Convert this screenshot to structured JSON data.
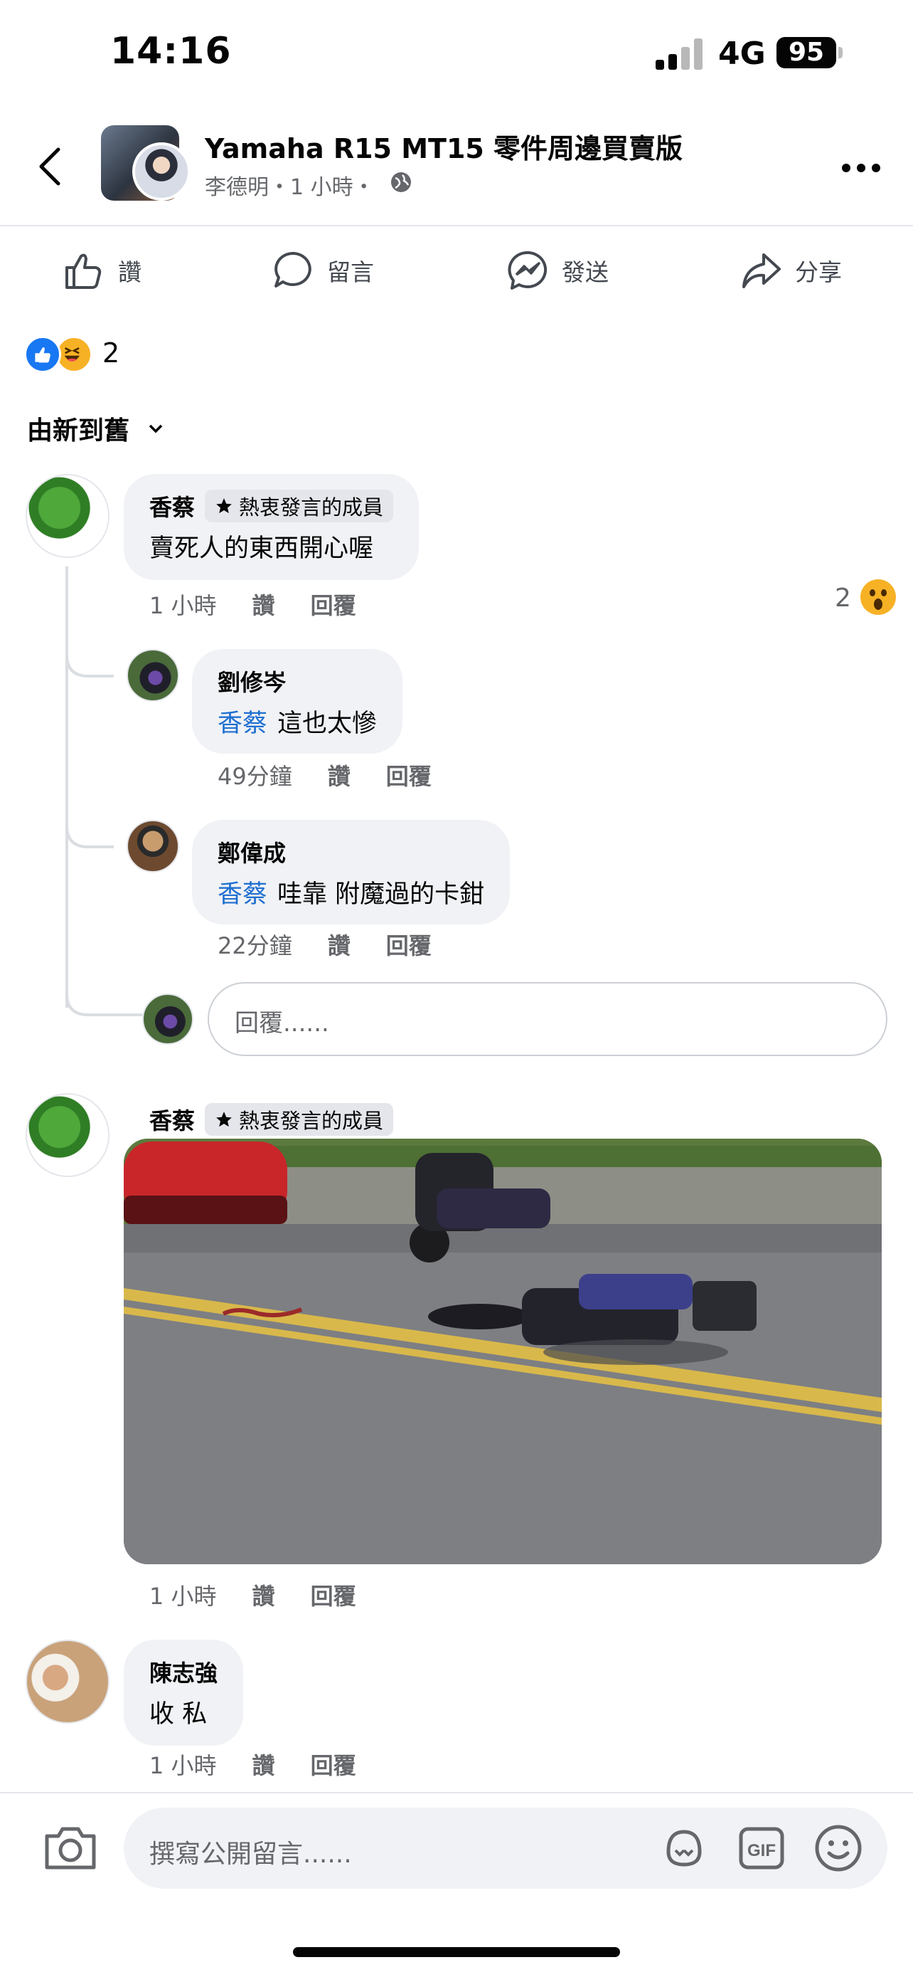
{
  "status_bar": {
    "time": "14:16",
    "network": "4G",
    "battery": "95"
  },
  "header": {
    "group_name": "Yamaha R15 MT15 零件周邊買賣版",
    "subtitle": "李德明・1 小時・",
    "icons": [
      "back-icon",
      "globe-icon",
      "more-icon"
    ]
  },
  "actions": [
    {
      "label": "讚",
      "icon": "like-icon"
    },
    {
      "label": "留言",
      "icon": "comment-icon"
    },
    {
      "label": "發送",
      "icon": "messenger-icon"
    },
    {
      "label": "分享",
      "icon": "share-icon"
    }
  ],
  "reactions": {
    "count": "2",
    "types": [
      "like",
      "haha"
    ]
  },
  "sort": {
    "label": "由新到舊"
  },
  "comments": [
    {
      "author": "香蔡",
      "badge": "熱衷發言的成員",
      "text": "賣死人的東西開心喔",
      "time": "1 小時",
      "like": "讚",
      "reply": "回覆",
      "reaction_count": "2",
      "reaction_type": "wow",
      "replies": [
        {
          "author": "劉修岑",
          "mention": "香蔡",
          "text": "這也太慘",
          "time": "49分鐘",
          "like": "讚",
          "reply": "回覆"
        },
        {
          "author": "鄭偉成",
          "mention": "香蔡",
          "text": "哇靠 附魔過的卡鉗",
          "time": "22分鐘",
          "like": "讚",
          "reply": "回覆"
        }
      ],
      "reply_placeholder": "回覆......"
    },
    {
      "author": "香蔡",
      "badge": "熱衷發言的成員",
      "image": "motorcycle crash photo",
      "time": "1 小時",
      "like": "讚",
      "reply": "回覆"
    },
    {
      "author": "陳志強",
      "text": "收 私",
      "time": "1 小時",
      "like": "讚",
      "reply": "回覆"
    }
  ],
  "composer": {
    "placeholder": "撰寫公開留言......",
    "icons": [
      "camera-icon",
      "avatar-sticker-icon",
      "gif-icon",
      "emoji-icon"
    ]
  }
}
